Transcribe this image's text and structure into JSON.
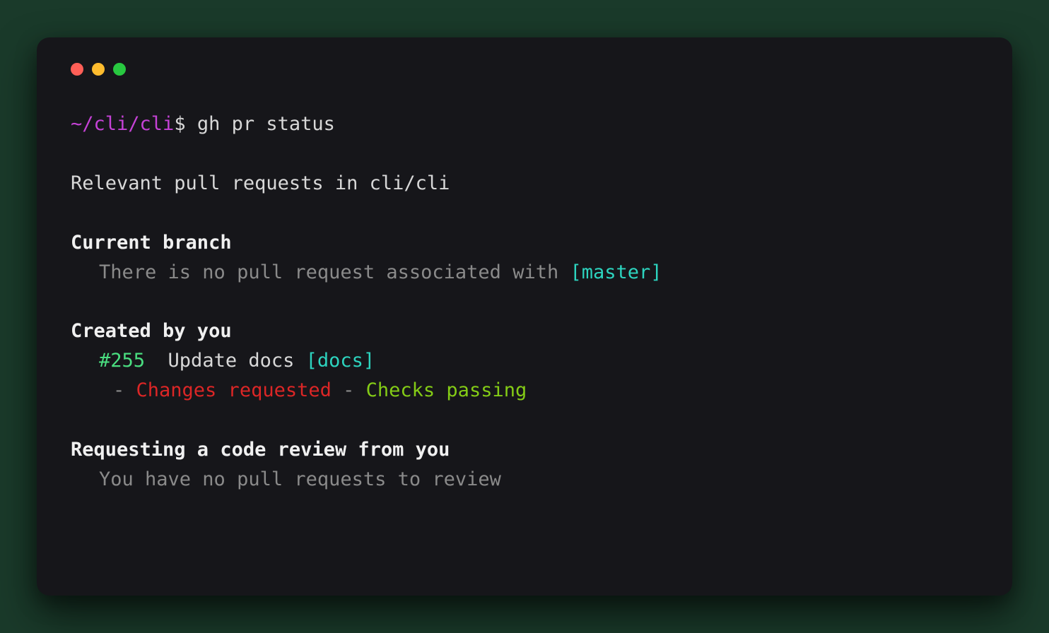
{
  "prompt": {
    "path": "~/cli/cli",
    "dollar": "$",
    "command": "gh pr status"
  },
  "summary": "Relevant pull requests in cli/cli",
  "sections": {
    "current_branch": {
      "header": "Current branch",
      "text_prefix": "There is no pull request associated with ",
      "branch": "[master]"
    },
    "created_by_you": {
      "header": "Created by you",
      "pr_number": "#255",
      "pr_title": "Update docs",
      "pr_branch": "[docs]",
      "status_prefix": "- ",
      "status1": "Changes requested",
      "status_sep": " - ",
      "status2": "Checks passing"
    },
    "requesting_review": {
      "header": "Requesting a code review from you",
      "text": "You have no pull requests to review"
    }
  }
}
